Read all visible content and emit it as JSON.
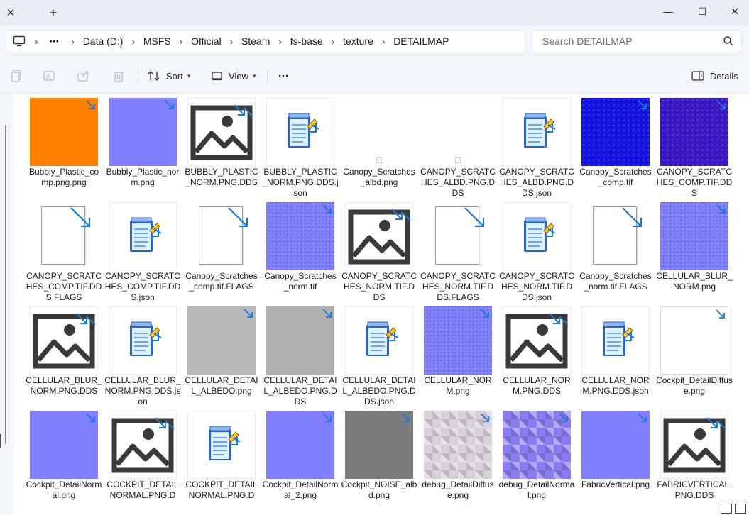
{
  "window": {
    "tab_close_glyph": "✕",
    "tab_new_glyph": "+",
    "controls": {
      "minimize": "—",
      "maximize": "☐",
      "close": "✕"
    }
  },
  "address": {
    "more": "⋯",
    "crumbs": [
      "Data (D:)",
      "MSFS",
      "Official",
      "Steam",
      "fs-base",
      "texture",
      "DETAILMAP"
    ],
    "search_placeholder": "Search DETAILMAP"
  },
  "commands": {
    "sort_label": "Sort",
    "view_label": "View",
    "more_label": "···",
    "details_label": "Details"
  },
  "colors": {
    "orange": "#ff7f00",
    "normal_blue": "#8080ff",
    "deep_blue": "#1414e6",
    "purple_blue": "#3a18c8",
    "gray": "#b8b8b8",
    "dark_gray": "#7c7c7c",
    "shortcut_arrow": "#1e78d4"
  },
  "files": [
    {
      "name": "Bubbly_Plastic_comp.png.png",
      "kind": "solid",
      "color": "#ff7f00"
    },
    {
      "name": "Bubbly_Plastic_norm.png",
      "kind": "solid",
      "color": "#8080ff"
    },
    {
      "name": "BUBBLY_PLASTIC_NORM.PNG.DDS",
      "kind": "image"
    },
    {
      "name": "BUBBLY_PLASTIC_NORM.PNG.DDS.json",
      "kind": "json"
    },
    {
      "name": "Canopy_Scratches_albd.png",
      "kind": "blank"
    },
    {
      "name": "CANOPY_SCRATCHES_ALBD.PNG.DDS",
      "kind": "blank"
    },
    {
      "name": "CANOPY_SCRATCHES_ALBD.PNG.DDS.json",
      "kind": "json"
    },
    {
      "name": "Canopy_Scratches_comp.tif",
      "kind": "texture",
      "color": "#1414e6"
    },
    {
      "name": "CANOPY_SCRATCHES_COMP.TIF.DDS",
      "kind": "texture",
      "color": "#3a18c8"
    },
    {
      "name": "CANOPY_SCRATCHES_COMP.TIF.DDS.FLAGS",
      "kind": "doc"
    },
    {
      "name": "CANOPY_SCRATCHES_COMP.TIF.DDS.json",
      "kind": "json"
    },
    {
      "name": "Canopy_Scratches_comp.tif.FLAGS",
      "kind": "doc"
    },
    {
      "name": "Canopy_Scratches_norm.tif",
      "kind": "texture",
      "color": "#8080ff"
    },
    {
      "name": "CANOPY_SCRATCHES_NORM.TIF.DDS",
      "kind": "image"
    },
    {
      "name": "CANOPY_SCRATCHES_NORM.TIF.DDS.FLAGS",
      "kind": "doc"
    },
    {
      "name": "CANOPY_SCRATCHES_NORM.TIF.DDS.json",
      "kind": "json"
    },
    {
      "name": "Canopy_Scratches_norm.tif.FLAGS",
      "kind": "doc"
    },
    {
      "name": "CELLULAR_BLUR_NORM.png",
      "kind": "texture",
      "color": "#8080ff"
    },
    {
      "name": "CELLULAR_BLUR_NORM.PNG.DDS",
      "kind": "image"
    },
    {
      "name": "CELLULAR_BLUR_NORM.PNG.DDS.json",
      "kind": "json"
    },
    {
      "name": "CELLULAR_DETAIL_ALBEDO.png",
      "kind": "solid",
      "color": "#b8b8b8"
    },
    {
      "name": "CELLULAR_DETAIL_ALBEDO.PNG.DDS",
      "kind": "solid",
      "color": "#b0b0b0"
    },
    {
      "name": "CELLULAR_DETAIL_ALBEDO.PNG.DDS.json",
      "kind": "json"
    },
    {
      "name": "CELLULAR_NORM.png",
      "kind": "texture",
      "color": "#8080ff"
    },
    {
      "name": "CELLULAR_NORM.PNG.DDS",
      "kind": "image"
    },
    {
      "name": "CELLULAR_NORM.PNG.DDS.json",
      "kind": "json"
    },
    {
      "name": "Cockpit_DetailDiffuse.png",
      "kind": "whitebox"
    },
    {
      "name": "Cockpit_DetailNormal.png",
      "kind": "solid",
      "color": "#8080ff"
    },
    {
      "name": "COCKPIT_DETAILNORMAL.PNG.D",
      "kind": "image"
    },
    {
      "name": "COCKPIT_DETAILNORMAL.PNG.D",
      "kind": "json"
    },
    {
      "name": "Cockpit_DetailNormal_2.png",
      "kind": "solid",
      "color": "#8080ff"
    },
    {
      "name": "Cockpit_NOISE_albd.png",
      "kind": "solid",
      "color": "#7c7c7c"
    },
    {
      "name": "debug_DetailDiffuse.png",
      "kind": "checker",
      "color": "#d8d0d8"
    },
    {
      "name": "debug_DetailNormal.png",
      "kind": "checker",
      "color": "#8a7cf0"
    },
    {
      "name": "FabricVertical.png",
      "kind": "solid",
      "color": "#8080ff"
    },
    {
      "name": "FABRICVERTICAL.PNG.DDS",
      "kind": "image"
    }
  ]
}
